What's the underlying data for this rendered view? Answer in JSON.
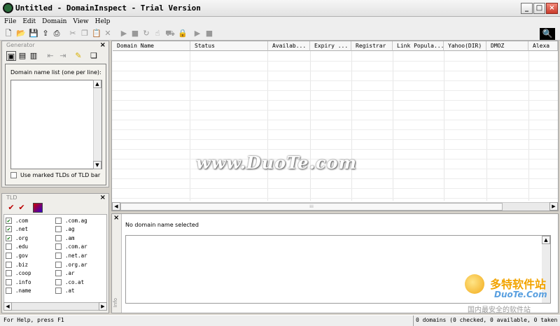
{
  "window": {
    "title": "Untitled - DomainInspect - Trial Version",
    "minimize": "_",
    "maximize": "□",
    "close": "×"
  },
  "menu": [
    {
      "id": "file",
      "label": "File"
    },
    {
      "id": "edit",
      "label": "Edit"
    },
    {
      "id": "domain",
      "label": "Domain"
    },
    {
      "id": "view",
      "label": "View"
    },
    {
      "id": "help",
      "label": "Help"
    }
  ],
  "generator": {
    "title": "Generator",
    "close": "×",
    "list_label": "Domain name list (one per line):",
    "use_tlds_label": "Use marked TLDs of TLD bar"
  },
  "tld_panel": {
    "title": "TLD",
    "close": "×",
    "items_col1": [
      {
        "label": ".com",
        "checked": true
      },
      {
        "label": ".net",
        "checked": true
      },
      {
        "label": ".org",
        "checked": true
      },
      {
        "label": ".edu",
        "checked": false
      },
      {
        "label": ".gov",
        "checked": false
      },
      {
        "label": ".biz",
        "checked": false
      },
      {
        "label": ".coop",
        "checked": false
      },
      {
        "label": ".info",
        "checked": false
      },
      {
        "label": ".name",
        "checked": false
      }
    ],
    "items_col2": [
      {
        "label": ".com.ag",
        "checked": false
      },
      {
        "label": ".ag",
        "checked": false
      },
      {
        "label": ".am",
        "checked": false
      },
      {
        "label": ".com.ar",
        "checked": false
      },
      {
        "label": ".net.ar",
        "checked": false
      },
      {
        "label": ".org.ar",
        "checked": false
      },
      {
        "label": ".ar",
        "checked": false
      },
      {
        "label": ".co.at",
        "checked": false
      },
      {
        "label": ".at",
        "checked": false
      }
    ]
  },
  "domain_list": {
    "columns": [
      "Domain Name",
      "Status",
      "Availab...",
      "Expiry ...",
      "Registrar",
      "Link Popula...",
      "Yahoo(DIR)",
      "DMOZ",
      "Alexa"
    ]
  },
  "info_panel": {
    "title": "Info",
    "close": "×",
    "message": "No domain name selected"
  },
  "statusbar": {
    "help": "For Help, press F1",
    "summary": "0 domains (0 checked, 0 available, 0 taken"
  },
  "watermark": {
    "main": "www.DuoTe.com",
    "brand": "多特软件站",
    "brand_url": "DuoTe.Com",
    "slogan": "国内最安全的软件站"
  }
}
